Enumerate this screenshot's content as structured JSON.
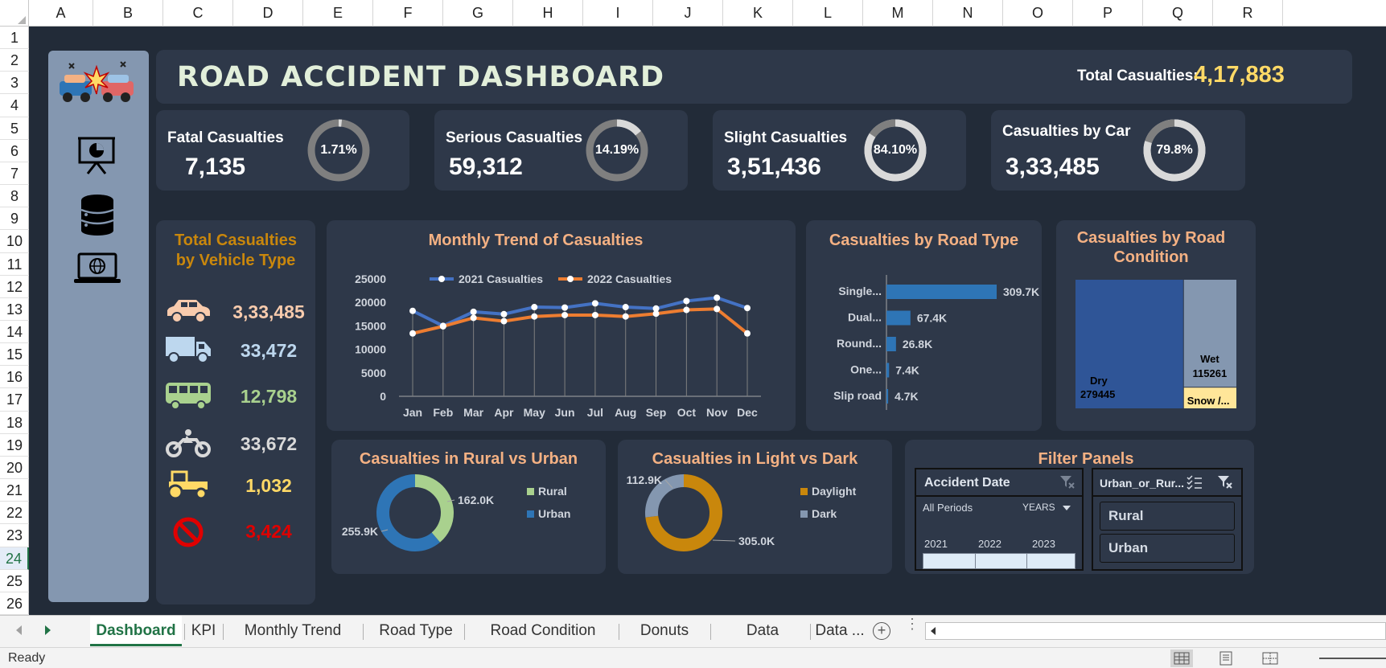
{
  "columns": [
    "A",
    "B",
    "C",
    "D",
    "E",
    "F",
    "G",
    "H",
    "I",
    "J",
    "K",
    "L",
    "M",
    "N",
    "O",
    "P",
    "Q",
    "R"
  ],
  "rows": [
    "1",
    "2",
    "3",
    "4",
    "5",
    "6",
    "7",
    "8",
    "9",
    "10",
    "11",
    "12",
    "13",
    "14",
    "15",
    "16",
    "17",
    "18",
    "19",
    "20",
    "21",
    "22",
    "23",
    "24",
    "25",
    "26"
  ],
  "active_row": "24",
  "header": {
    "title": "ROAD ACCIDENT DASHBOARD",
    "total_label": "Total Casualties:",
    "total_value": "4,17,883"
  },
  "sidebar": {
    "icons": [
      "car-crash-icon",
      "presentation-chart-icon",
      "database-icon",
      "laptop-globe-icon"
    ]
  },
  "kpis": [
    {
      "label": "Fatal Casualties",
      "value": "7,135",
      "pct_text": "1.71%",
      "fraction": 0.0171
    },
    {
      "label": "Serious Casualties",
      "value": "59,312",
      "pct_text": "14.19%",
      "fraction": 0.1419
    },
    {
      "label": "Slight Casualties",
      "value": "3,51,436",
      "pct_text": "84.10%",
      "fraction": 0.841
    },
    {
      "label": "Casualties by Car",
      "value": "3,33,485",
      "pct_text": "79.8%",
      "fraction": 0.798
    }
  ],
  "vehicle_panel": {
    "title_line1": "Total Casualties",
    "title_line2": "by Vehicle Type",
    "items": [
      {
        "icon": "car-icon",
        "value": "3,33,485",
        "color": "#f8cbad"
      },
      {
        "icon": "truck-icon",
        "value": "33,472",
        "color": "#bdd7ee"
      },
      {
        "icon": "bus-icon",
        "value": "12,798",
        "color": "#a9d18e"
      },
      {
        "icon": "motorcycle-icon",
        "value": "33,672",
        "color": "#d9d9d9"
      },
      {
        "icon": "tractor-icon",
        "value": "1,032",
        "color": "#ffd966"
      },
      {
        "icon": "no-entry-icon",
        "value": "3,424",
        "color": "#e00000"
      }
    ]
  },
  "chart_data": [
    {
      "type": "line",
      "title": "Monthly Trend of Casualties",
      "categories": [
        "Jan",
        "Feb",
        "Mar",
        "Apr",
        "May",
        "Jun",
        "Jul",
        "Aug",
        "Sep",
        "Oct",
        "Nov",
        "Dec"
      ],
      "y_ticks": [
        "0",
        "5000",
        "10000",
        "15000",
        "20000",
        "25000"
      ],
      "ylim": [
        0,
        25000
      ],
      "series": [
        {
          "name": "2021 Casualties",
          "color": "#4472c4",
          "values": [
            18200,
            15000,
            18000,
            17500,
            19000,
            18900,
            19800,
            19000,
            18700,
            20300,
            21000,
            18800
          ]
        },
        {
          "name": "2022 Casualties",
          "color": "#ed7d31",
          "values": [
            13400,
            14900,
            16700,
            16000,
            17000,
            17300,
            17300,
            17000,
            17600,
            18400,
            18600,
            13400
          ]
        }
      ]
    },
    {
      "type": "bar",
      "orientation": "horizontal",
      "title": "Casualties by Road Type",
      "categories": [
        "Single...",
        "Dual...",
        "Round...",
        "One...",
        "Slip road"
      ],
      "values": [
        309.7,
        67.4,
        26.8,
        7.4,
        4.7
      ],
      "labels": [
        "309.7K",
        "67.4K",
        "26.8K",
        "7.4K",
        "4.7K"
      ]
    },
    {
      "type": "treemap",
      "title_line1": "Casualties by Road",
      "title_line2": "Condition",
      "items": [
        {
          "name": "Dry",
          "value": 279445,
          "value_text": "279445",
          "color": "#2f5597"
        },
        {
          "name": "Wet",
          "value": 115261,
          "value_text": "115261",
          "color": "#8497b0"
        },
        {
          "name": "Snow /...",
          "value": 23177,
          "value_text": "",
          "color": "#ffe699"
        }
      ]
    },
    {
      "type": "pie",
      "title": "Casualties in Rural vs Urban",
      "slices": [
        {
          "name": "Rural",
          "value": 162.0,
          "label": "162.0K",
          "color": "#a9d18e"
        },
        {
          "name": "Urban",
          "value": 255.9,
          "label": "255.9K",
          "color": "#2e75b6"
        }
      ]
    },
    {
      "type": "pie",
      "title": "Casualties in Light vs Dark",
      "slices": [
        {
          "name": "Daylight",
          "value": 305.0,
          "label": "305.0K",
          "color": "#c9870c"
        },
        {
          "name": "Dark",
          "value": 112.9,
          "label": "112.9K",
          "color": "#8497b0"
        }
      ]
    }
  ],
  "filter_panel": {
    "title": "Filter Panels",
    "date_slicer": {
      "title": "Accident Date",
      "period_label": "All Periods",
      "level_label": "YEARS",
      "years": [
        "2021",
        "2022",
        "2023"
      ]
    },
    "area_slicer": {
      "title": "Urban_or_Rur...",
      "options": [
        "Rural",
        "Urban"
      ]
    }
  },
  "tabs": [
    "Dashboard",
    "KPI",
    "Monthly Trend",
    "Road Type",
    "Road Condition",
    "Donuts",
    "Data Analysis",
    "Data ..."
  ],
  "active_tab": "Dashboard",
  "status": "Ready"
}
